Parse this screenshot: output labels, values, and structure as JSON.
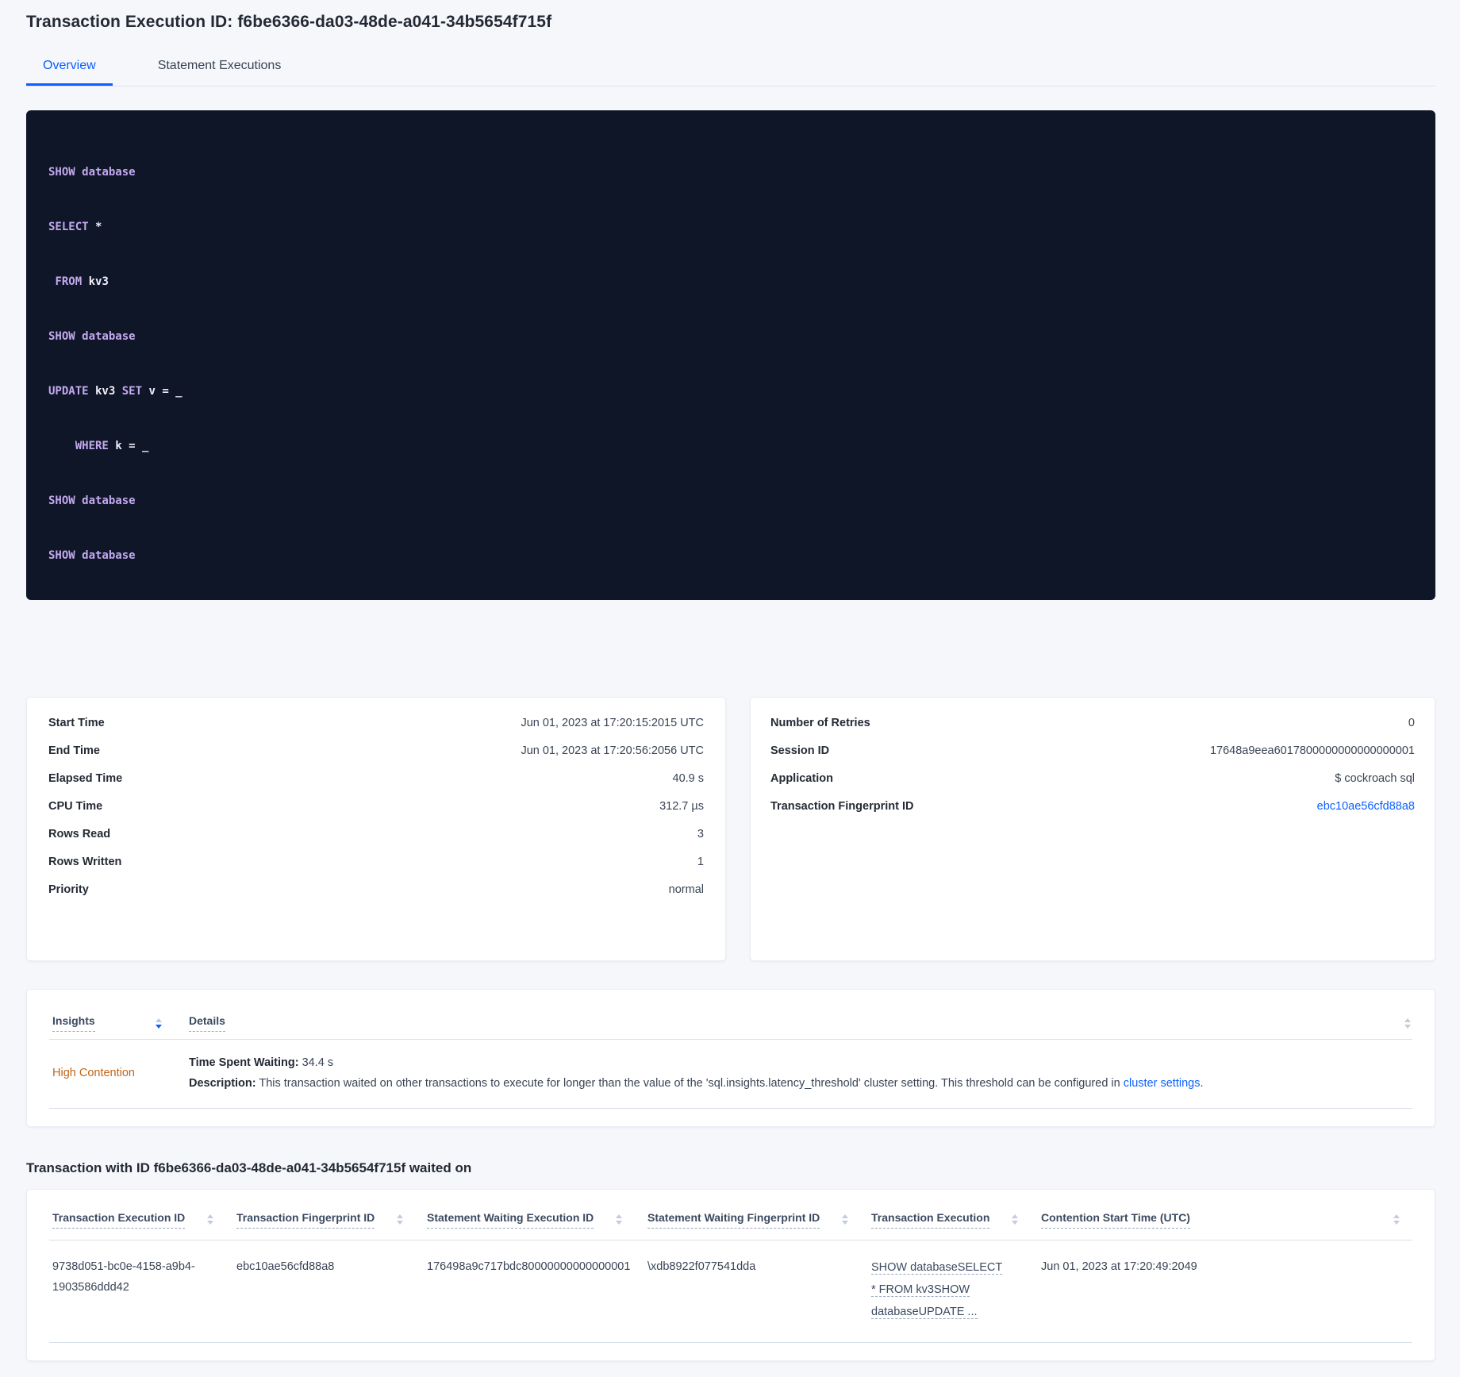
{
  "header": {
    "title": "Transaction Execution ID: f6be6366-da03-48de-a041-34b5654f715f",
    "tabs": [
      {
        "label": "Overview"
      },
      {
        "label": "Statement Executions"
      }
    ]
  },
  "sql": {
    "lines": [
      {
        "tokens": [
          {
            "text": "SHOW database",
            "type": "kw"
          }
        ]
      },
      {
        "tokens": [
          {
            "text": "SELECT",
            "type": "kw"
          },
          {
            "text": " *",
            "type": "plain"
          }
        ]
      },
      {
        "tokens": [
          {
            "text": " ",
            "type": "plain"
          },
          {
            "text": "FROM",
            "type": "kw"
          },
          {
            "text": " kv3",
            "type": "plain"
          }
        ]
      },
      {
        "tokens": [
          {
            "text": "SHOW database",
            "type": "kw"
          }
        ]
      },
      {
        "tokens": [
          {
            "text": "UPDATE",
            "type": "kw"
          },
          {
            "text": " kv3 ",
            "type": "plain"
          },
          {
            "text": "SET",
            "type": "kw"
          },
          {
            "text": " v = _",
            "type": "plain"
          }
        ]
      },
      {
        "tokens": [
          {
            "text": "    ",
            "type": "plain"
          },
          {
            "text": "WHERE",
            "type": "kw"
          },
          {
            "text": " k = _",
            "type": "plain"
          }
        ]
      },
      {
        "tokens": [
          {
            "text": "SHOW database",
            "type": "kw"
          }
        ]
      },
      {
        "tokens": [
          {
            "text": "SHOW database",
            "type": "kw"
          }
        ]
      }
    ]
  },
  "summary_card": {
    "rows": [
      {
        "label": "Start Time",
        "value": "Jun 01, 2023 at 17:20:15:2015 UTC"
      },
      {
        "label": "End Time",
        "value": "Jun 01, 2023 at 17:20:56:2056 UTC"
      },
      {
        "label": "Elapsed Time",
        "value": "40.9 s"
      },
      {
        "label": "CPU Time",
        "value": "312.7 µs"
      },
      {
        "label": "Rows Read",
        "value": "3"
      },
      {
        "label": "Rows Written",
        "value": "1"
      },
      {
        "label": "Priority",
        "value": "normal"
      }
    ]
  },
  "session_card": {
    "rows": [
      {
        "label": "Number of Retries",
        "value": "0"
      },
      {
        "label": "Session ID",
        "value": "17648a9eea6017800000000000000001"
      },
      {
        "label": "Application",
        "value": "$ cockroach sql"
      }
    ],
    "fingerprint": {
      "label": "Transaction Fingerprint ID",
      "value": "ebc10ae56cfd88a8"
    }
  },
  "insights_table": {
    "columns": [
      {
        "label": "Insights"
      },
      {
        "label": "Details"
      }
    ],
    "row": {
      "insight": "High Contention",
      "time_spent_waiting_label": "Time Spent Waiting:",
      "time_spent_waiting_value": " 34.4 s",
      "description_label": "Description:",
      "description_text": " This transaction waited on other transactions to execute for longer than the value of the 'sql.insights.latency_threshold' cluster setting. This threshold can be configured in ",
      "description_link": "cluster settings",
      "description_period": "."
    }
  },
  "waited_on": {
    "title": "Transaction with ID f6be6366-da03-48de-a041-34b5654f715f waited on",
    "columns": [
      {
        "label": "Transaction Execution ID"
      },
      {
        "label": "Transaction Fingerprint ID"
      },
      {
        "label": "Statement Waiting Execution ID"
      },
      {
        "label": "Statement Waiting Fingerprint ID"
      },
      {
        "label": "Transaction Execution"
      },
      {
        "label": "Contention Start Time (UTC)"
      }
    ],
    "row": {
      "transaction_execution_id": "9738d051-bc0e-4158-a9b4-1903586ddd42",
      "transaction_fingerprint_id": "ebc10ae56cfd88a8",
      "statement_waiting_execution_id": "176498a9c717bdc80000000000000001",
      "statement_waiting_fingerprint_id": "\\xdb8922f077541dda",
      "transaction_execution": "SHOW databaseSELECT * FROM kv3SHOW databaseUPDATE ...",
      "contention_start_time": "Jun 01, 2023 at 17:20:49:2049"
    }
  },
  "colors": {
    "accent_blue": "#0b5fff",
    "contention_orange": "#c26416",
    "code_background": "#0e1628",
    "code_keyword": "#c5a9ef",
    "page_background": "#f5f7fa"
  }
}
